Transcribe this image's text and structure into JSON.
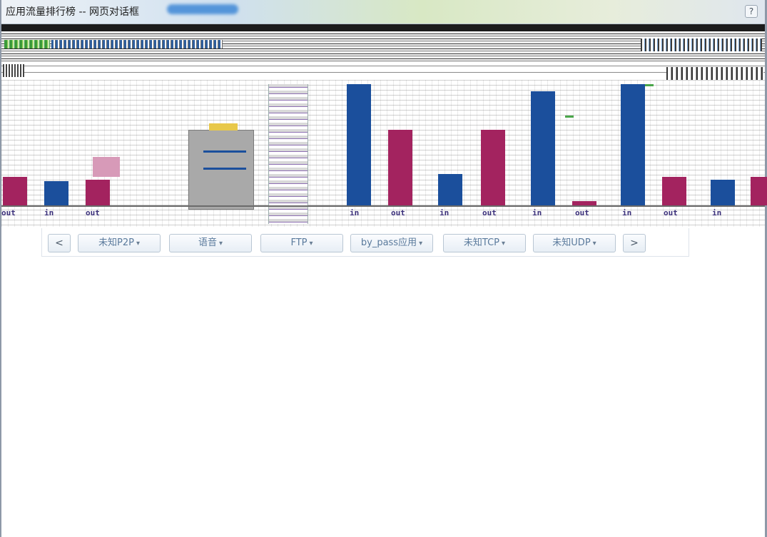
{
  "window": {
    "title": "应用流量排行榜 -- 网页对话框",
    "help_icon": "?"
  },
  "chart_data": {
    "type": "bar",
    "categories": [
      "in",
      "out",
      "in",
      "out",
      "in",
      "out",
      "in",
      "out",
      "in",
      "out",
      "in",
      "out",
      "in",
      "out",
      "in",
      "out"
    ],
    "series_labels": [
      "in",
      "out"
    ],
    "colors": {
      "in": "#1b4f9c",
      "out": "#a3235f"
    }
  },
  "bar_labels": [
    "out",
    "in",
    "out",
    "in",
    "out",
    "in",
    "out",
    "in",
    "out",
    "in",
    "out",
    "in"
  ],
  "selector": {
    "prev": "<",
    "next": ">",
    "categories": [
      "未知P2P",
      "语音",
      "FTP",
      "by_pass应用",
      "未知TCP",
      "未知UDP"
    ],
    "caret": "▾"
  }
}
